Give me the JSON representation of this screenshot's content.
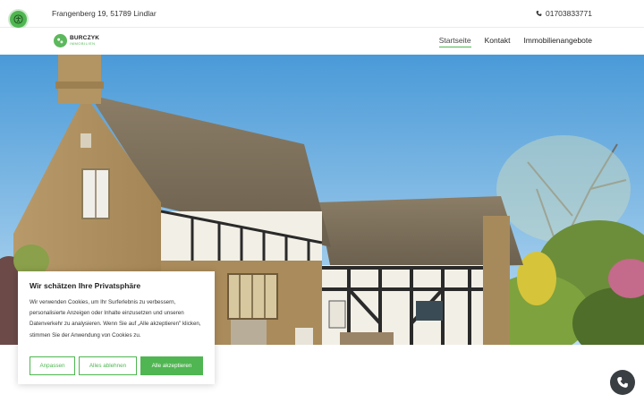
{
  "topbar": {
    "address": "Frangenberg 19, 51789 Lindlar",
    "phone": "01703833771"
  },
  "brand": {
    "name": "BURCZYK",
    "tagline": "IMMOBILIEN"
  },
  "nav": {
    "items": [
      {
        "label": "Startseite",
        "active": true
      },
      {
        "label": "Kontakt",
        "active": false
      },
      {
        "label": "Immobilienangebote",
        "active": false
      }
    ]
  },
  "cookie_banner": {
    "title": "Wir schätzen Ihre Privatsphäre",
    "body": "Wir verwenden Cookies, um Ihr Surferlebnis zu verbessern, personalisierte Anzeigen oder Inhalte einzusetzen und unseren Datenverkehr zu analysieren. Wenn Sie auf „Alle akzeptieren\" klicken, stimmen Sie der Anwendung von Cookies zu.",
    "customize_label": "Anpassen",
    "reject_label": "Alles ablehnen",
    "accept_label": "Alle akzeptieren"
  },
  "icons": {
    "accessibility": "accessibility-icon",
    "phone": "phone-icon",
    "call": "call-icon",
    "logo": "logo-icon"
  },
  "colors": {
    "accent": "#4fb651",
    "dark": "#3a3f44"
  }
}
